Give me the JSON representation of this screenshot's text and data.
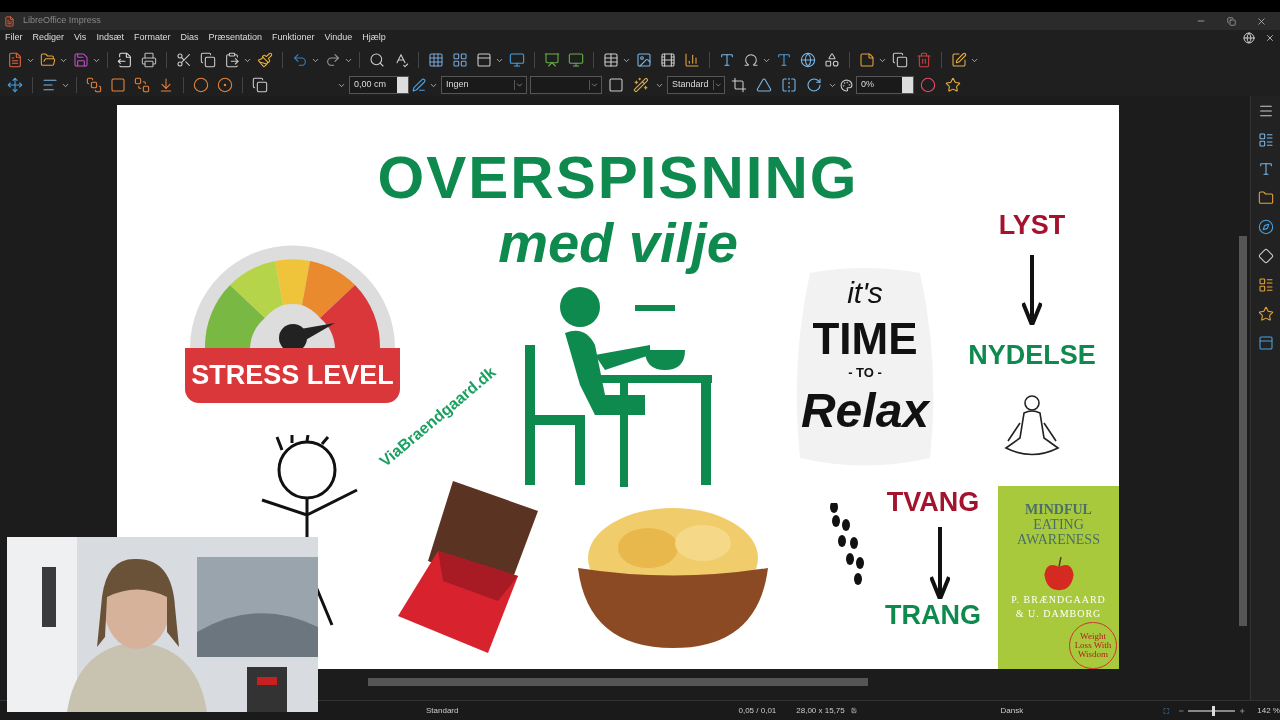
{
  "window": {
    "title": "LibreOffice Impress"
  },
  "menu": [
    "Filer",
    "Rediger",
    "Vis",
    "Indsæt",
    "Formater",
    "Dias",
    "Præsentation",
    "Funktioner",
    "Vindue",
    "Hjælp"
  ],
  "toolbar_fields": {
    "line_width": "0,00 cm",
    "line_style": "Ingen",
    "area_style": "Standard",
    "transparency": "0%"
  },
  "slide": {
    "title": "OVERSPISNING",
    "subtitle": "med vilje",
    "gauge_label": "STRESS LEVEL",
    "website": "ViaBraendgaard.dk",
    "sticker": [
      "it's",
      "TIME",
      "- TO -",
      "Relax"
    ],
    "flows": [
      {
        "top": "LYST",
        "bottom": "NYDELSE"
      },
      {
        "top": "TVANG",
        "bottom": "TRANG"
      }
    ],
    "book": {
      "title": [
        "MINDFUL",
        "EATING",
        "AWARENESS"
      ],
      "authors": [
        "P. BRÆNDGAARD",
        "& U. DAMBORG"
      ],
      "badge": "Weight Loss With Wisdom"
    }
  },
  "status_bar": {
    "layout": "Standard",
    "position": "0,05 / 0,01",
    "size": "28,00 x 15,75",
    "language": "Dansk",
    "zoom": "142 %"
  },
  "zoom_slider": {
    "level": 0.5
  }
}
